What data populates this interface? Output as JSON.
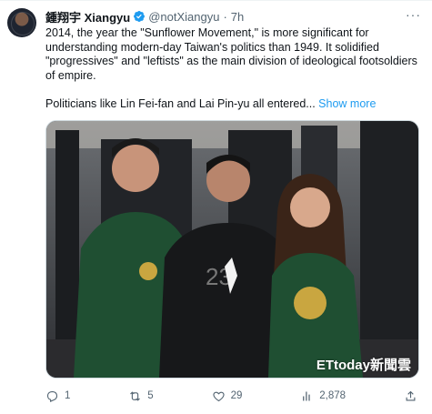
{
  "tweet": {
    "display_name": "鍾翔宇 Xiangyu",
    "handle": "@notXiangyu",
    "separator": "·",
    "time": "7h",
    "more_icon": "ellipsis-icon",
    "text": "2014, the year the \"Sunflower Movement,\" is more significant for understanding modern-day Taiwan's politics than 1949. It solidified \"progressives\" and \"leftists\" as the main division of ideological footsoldiers of empire.\n\nPoliticians like Lin Fei-fan and Lai Pin-yu all entered...",
    "show_more": "Show more",
    "verified_color": "#1d9bf0",
    "link_color": "#1d9bf0"
  },
  "media": {
    "watermark": "ETtoday新聞雲"
  },
  "actions": {
    "replies": "1",
    "retweets": "5",
    "likes": "29",
    "views": "2,878"
  }
}
